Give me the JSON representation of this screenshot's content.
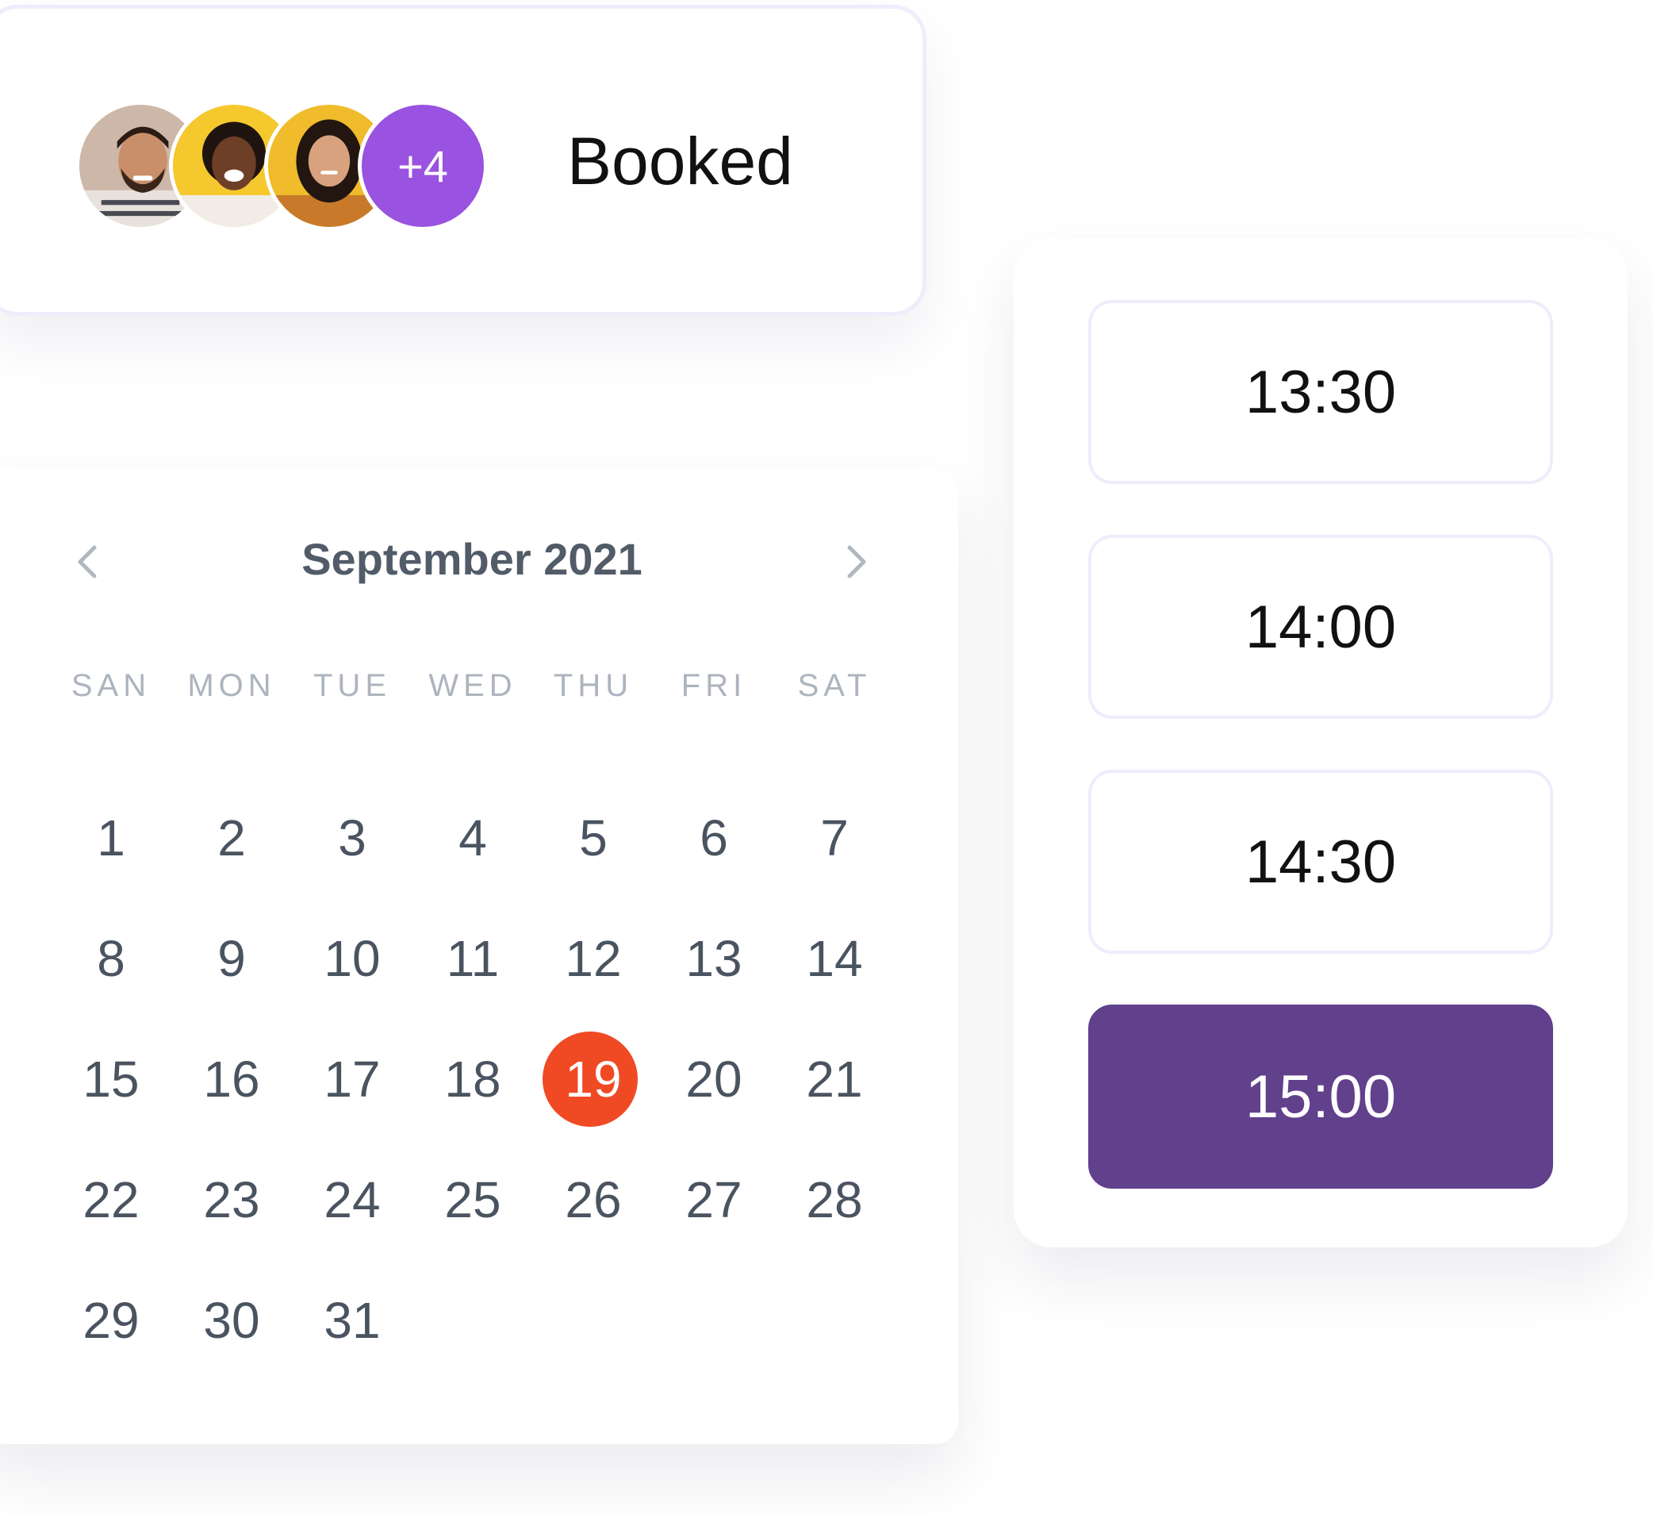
{
  "booking": {
    "status_label": "Booked",
    "more_count": "+4"
  },
  "calendar": {
    "month_label": "September 2021",
    "weekdays": [
      "SAN",
      "MON",
      "TUE",
      "WED",
      "THU",
      "FRI",
      "SAT"
    ],
    "weeks": [
      [
        "1",
        "2",
        "3",
        "4",
        "5",
        "6",
        "7"
      ],
      [
        "8",
        "9",
        "10",
        "11",
        "12",
        "13",
        "14"
      ],
      [
        "15",
        "16",
        "17",
        "18",
        "19",
        "20",
        "21"
      ],
      [
        "22",
        "23",
        "24",
        "25",
        "26",
        "27",
        "28"
      ],
      [
        "29",
        "30",
        "31"
      ]
    ],
    "selected_day": "19",
    "selected_color": "#ef4a24"
  },
  "time_slots": {
    "slots": [
      "13:30",
      "14:00",
      "14:30",
      "15:00"
    ],
    "selected": "15:00",
    "selected_color": "#61408c"
  },
  "icons": {
    "prev": "chevron-left-icon",
    "next": "chevron-right-icon"
  }
}
